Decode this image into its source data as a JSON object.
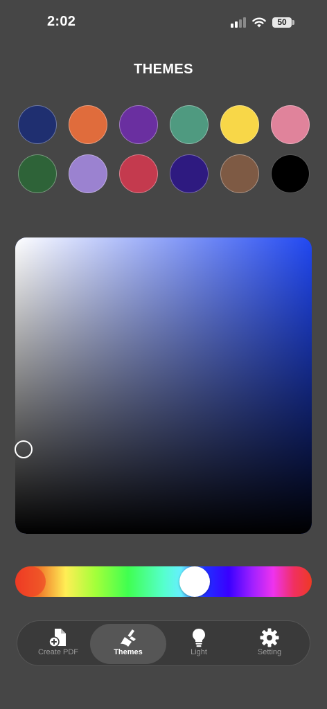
{
  "status_bar": {
    "time": "2:02",
    "battery": "50",
    "icons": [
      "cellular-signal-icon",
      "wifi-icon",
      "battery-icon"
    ]
  },
  "page": {
    "title": "THEMES"
  },
  "swatches": [
    {
      "name": "navy",
      "color": "#1f2f70"
    },
    {
      "name": "orange",
      "color": "#e06c3c"
    },
    {
      "name": "purple",
      "color": "#6a2fa0"
    },
    {
      "name": "teal",
      "color": "#4f9a80"
    },
    {
      "name": "yellow",
      "color": "#f8d748"
    },
    {
      "name": "pink",
      "color": "#e0839b"
    },
    {
      "name": "green",
      "color": "#2e6338"
    },
    {
      "name": "lavender",
      "color": "#9b82d0"
    },
    {
      "name": "crimson",
      "color": "#c43a4e"
    },
    {
      "name": "indigo",
      "color": "#2e1a80"
    },
    {
      "name": "brown",
      "color": "#7e5a44"
    },
    {
      "name": "black",
      "color": "#000000"
    }
  ],
  "color_picker": {
    "hue_color": "#2148f2",
    "hue_fraction": 0.59,
    "selected_saturation": 0.02,
    "selected_brightness": 0.28
  },
  "tab_bar": {
    "items": [
      {
        "label": "Create PDF",
        "icon": "create-pdf-icon",
        "active": false
      },
      {
        "label": "Themes",
        "icon": "paintbrush-icon",
        "active": true
      },
      {
        "label": "Light",
        "icon": "lightbulb-icon",
        "active": false
      },
      {
        "label": "Setting",
        "icon": "gear-icon",
        "active": false
      }
    ]
  }
}
